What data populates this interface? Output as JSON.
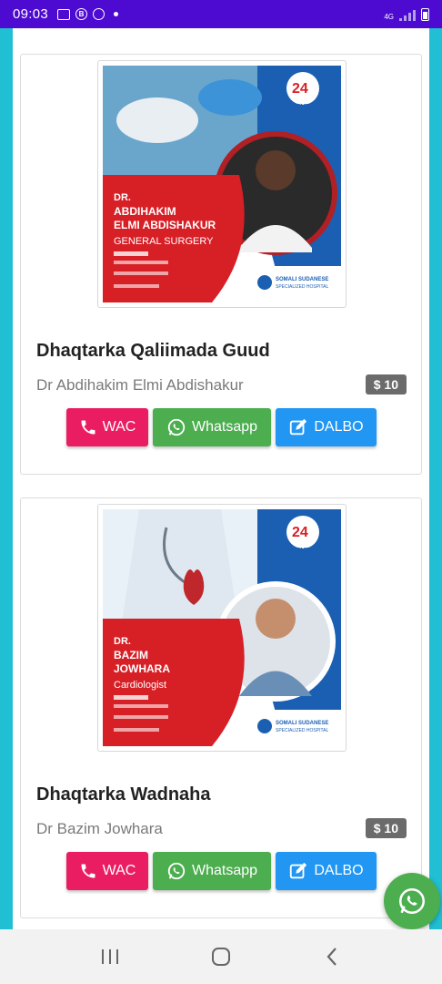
{
  "status_bar": {
    "time": "09:03",
    "network": "4G",
    "icons": [
      "gallery-icon",
      "b-icon",
      "chrome-icon",
      "notification-dot-icon",
      "signal-icon",
      "battery-icon"
    ]
  },
  "cards": [
    {
      "title": "Dhaqtarka Qaliimada Guud",
      "doctor": "Dr Abdihakim Elmi Abdishakur",
      "price": "$ 10",
      "poster": {
        "badge_number": "24",
        "badge_text": "EVERYDAY",
        "prefix": "DR.",
        "name_line1": "ABDIHAKIM",
        "name_line2": "ELMI ABDISHAKUR",
        "specialty": "GENERAL SURGERY",
        "hospital_line1": "SOMALI SUDANESE",
        "hospital_line2": "SPECIALIZED HOSPITAL"
      },
      "buttons": {
        "call": "WAC",
        "whatsapp": "Whatsapp",
        "book": "DALBO"
      }
    },
    {
      "title": "Dhaqtarka Wadnaha",
      "doctor": "Dr Bazim Jowhara",
      "price": "$ 10",
      "poster": {
        "badge_number": "24",
        "badge_text": "EVERYDAY",
        "prefix": "DR.",
        "name_line1": "BAZIM",
        "name_line2": "JOWHARA",
        "specialty": "Cardiologist",
        "hospital_line1": "SOMALI SUDANESE",
        "hospital_line2": "SPECIALIZED HOSPITAL"
      },
      "buttons": {
        "call": "WAC",
        "whatsapp": "Whatsapp",
        "book": "DALBO"
      }
    }
  ],
  "colors": {
    "status_bar": "#4d0bd1",
    "page_background": "#20bfd3",
    "call_button": "#ea1d63",
    "whatsapp_button": "#4cae4f",
    "book_button": "#2196f3",
    "price_badge": "#6b6b6b"
  },
  "nav_bar": {
    "buttons": [
      "recent-apps-icon",
      "home-icon",
      "back-icon"
    ]
  }
}
